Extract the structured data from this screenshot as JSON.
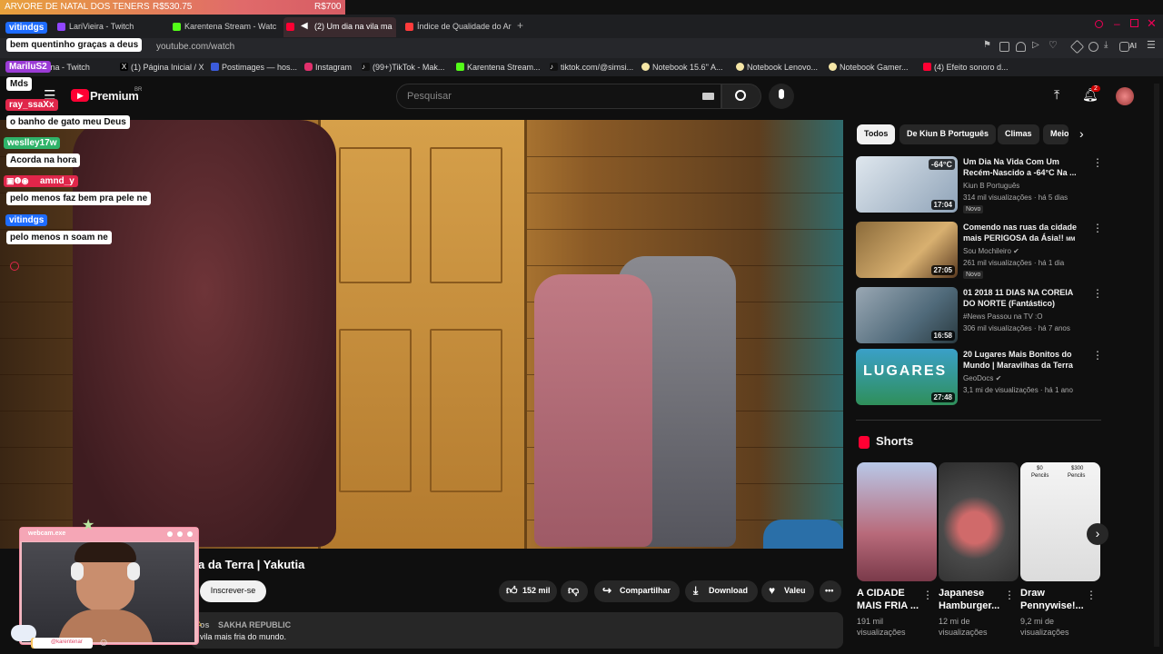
{
  "goal": {
    "label": "ARVORE DE NATAL DOS TENERS",
    "current": "R$530.75",
    "target": "R$700"
  },
  "tabs": [
    {
      "label": "LariVieira - Twitch",
      "color": "#9146ff"
    },
    {
      "label": "Karentena Stream - Watc",
      "color": "#53fc18"
    },
    {
      "label": "(2) Um dia na vila ma",
      "color": "#ff0033",
      "active": true
    },
    {
      "label": "Índice de Qualidade do Ar",
      "color": "#ff3b3b"
    }
  ],
  "url": "youtube.com/watch",
  "bookmarks": [
    {
      "label": "tena - Twitch",
      "color": "#9146ff"
    },
    {
      "label": "(1) Página Inicial / X",
      "color": "#000"
    },
    {
      "label": "Postimages — hos...",
      "color": "#3b5bdb"
    },
    {
      "label": "Instagram",
      "color": "#e1306c"
    },
    {
      "label": "(99+)TikTok - Mak...",
      "color": "#111"
    },
    {
      "label": "Karentena Stream...",
      "color": "#53fc18"
    },
    {
      "label": "tiktok.com/@simsi...",
      "color": "#111"
    },
    {
      "label": "Notebook 15.6'' A...",
      "color": "#f5e6a6"
    },
    {
      "label": "Notebook Lenovo...",
      "color": "#f5e6a6"
    },
    {
      "label": "Notebook Gamer...",
      "color": "#f5e6a6"
    },
    {
      "label": "(4) Efeito sonoro d...",
      "color": "#ff0033"
    }
  ],
  "youtube": {
    "logo": "Premium",
    "region": "BR",
    "search_placeholder": "Pesquisar",
    "notif_count": "2"
  },
  "video": {
    "title": "a da Terra | Yakutia",
    "subscribe": "Inscrever-se",
    "likes": "152 mil",
    "share": "Compartilhar",
    "download": "Download",
    "thanks": "Valeu",
    "desc_tag": "SAKHA REPUBLIC",
    "desc_prefix": "os",
    "desc_text": "vila mais fria do mundo."
  },
  "chips": [
    "Todos",
    "De Kiun B Português",
    "Climas",
    "Meio"
  ],
  "related": [
    {
      "title": "Um Dia Na Vida Com Um Recém-Nascido a -64°C Na ...",
      "channel": "Kiun B Português",
      "meta": "314 mil visualizações · há 5 dias",
      "duration": "17:04",
      "badge": "-64°C",
      "new": "Novo"
    },
    {
      "title": "Comendo nas ruas da cidade mais PERIGOSA da Ásia!!",
      "title_suffix": "MM",
      "channel": "Sou Mochileiro",
      "meta": "261 mil visualizações · há 1 dia",
      "duration": "27:05",
      "new": "Novo"
    },
    {
      "title": "01 2018 11 DIAS NA COREIA DO NORTE (Fantástico)",
      "channel": "#News Passou na TV :O",
      "meta": "306 mil visualizações · há 7 anos",
      "duration": "16:58"
    },
    {
      "title": "20 Lugares Mais Bonitos do Mundo | Maravilhas da Terra",
      "channel": "GeoDocs",
      "meta": "3,1 mi de visualizações · há 1 ano",
      "duration": "27:48",
      "overlay": "LUGARES"
    }
  ],
  "shorts": {
    "heading": "Shorts",
    "items": [
      {
        "title": "A CIDADE MAIS FRIA ...",
        "views": "191 mil visualizações"
      },
      {
        "title": "Japanese Hamburger...",
        "views": "12 mi de visualizações"
      },
      {
        "title": "Draw Pennywise!...",
        "views": "9,2 mi de visualizações",
        "price_a": "$0",
        "price_b": "$300",
        "pencils": "Pencils"
      }
    ]
  },
  "chat": [
    {
      "user": "vitindgs",
      "msg": "bem quentinho graças a deus",
      "color": "#1e6cff"
    },
    {
      "user": "MariluS2",
      "msg": "Mds",
      "color": "#9b3bd6"
    },
    {
      "user": "ray_ssaXx",
      "msg": "o banho de gato meu Deus",
      "color": "#e0264a"
    },
    {
      "user": "weslley17w",
      "msg": "Acorda na hora",
      "color": "#2fb36a"
    },
    {
      "user": "amnd_y",
      "msg": "pelo menos faz bem pra pele ne",
      "color": "#e0264a"
    },
    {
      "user": "vitindgs",
      "msg": "pelo menos n soam ne",
      "color": "#1e6cff"
    }
  ],
  "webcam": {
    "title": "webcam.exe",
    "handle": "@karentenar"
  }
}
